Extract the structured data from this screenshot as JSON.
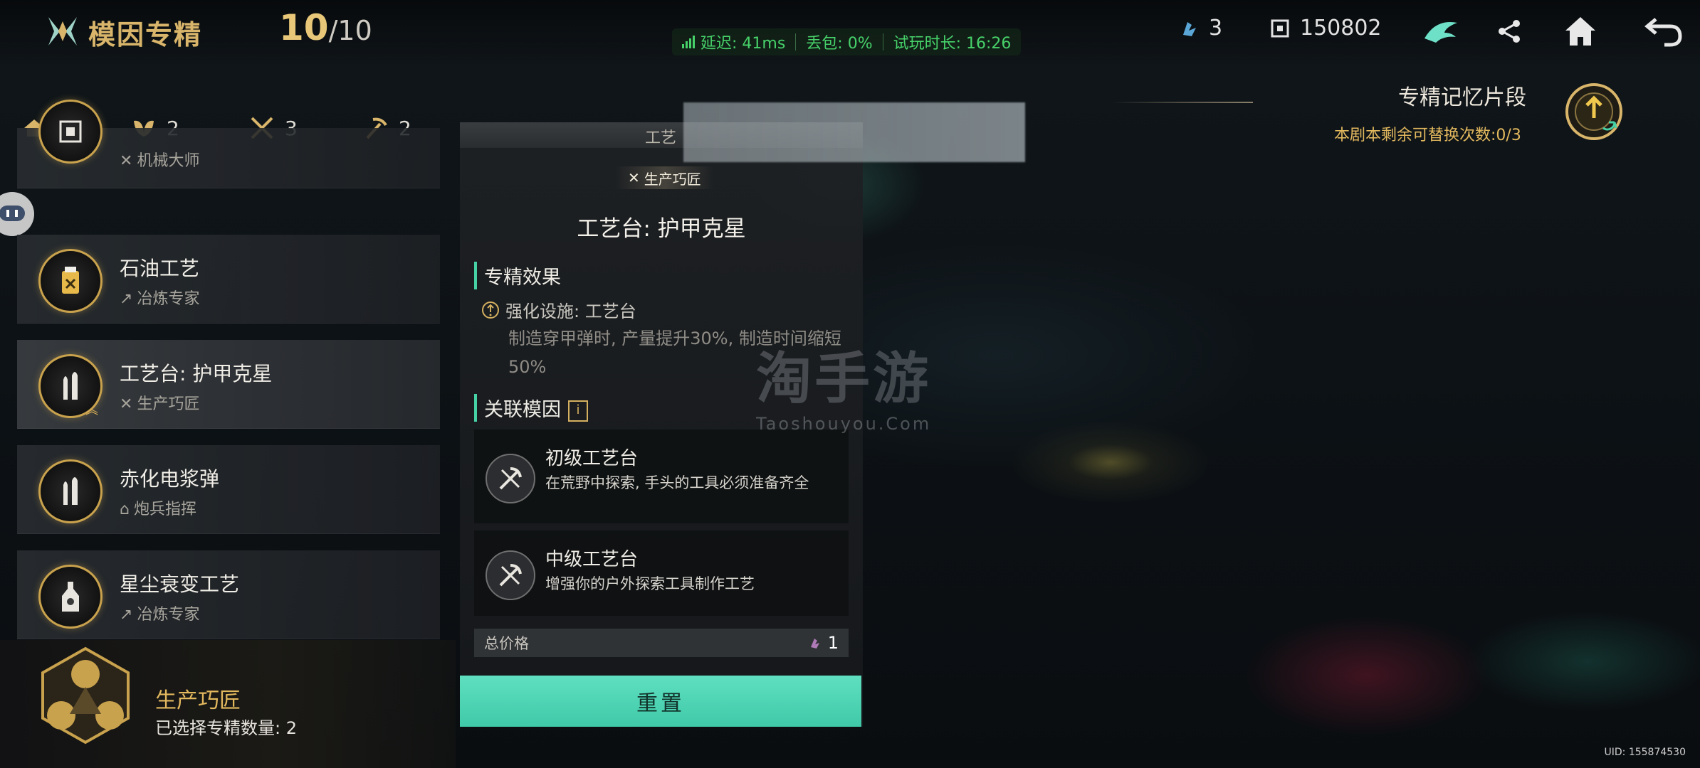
{
  "header": {
    "title": "模因专精",
    "count_current": "10",
    "count_max": "10",
    "count_sep": "/"
  },
  "netstat": {
    "latency": "延迟: 41ms",
    "packet_loss": "丢包: 0%",
    "trial_time": "试玩时长: 16:26"
  },
  "resources": {
    "fragment_count": "3",
    "currency_count": "150802"
  },
  "filters": [
    {
      "icon": "house-icon",
      "count": "3"
    },
    {
      "icon": "leaf-icon",
      "count": "2"
    },
    {
      "icon": "crossed-tools-icon",
      "count": "3"
    },
    {
      "icon": "pickaxe-icon",
      "count": "2"
    }
  ],
  "list": {
    "items": [
      {
        "title": "",
        "sub": "机械大师",
        "sub_icon": "✕"
      },
      {
        "title": "石油工艺",
        "sub": "冶炼专家",
        "sub_icon": "↗"
      },
      {
        "title": "工艺台: 护甲克星",
        "sub": "生产巧匠",
        "sub_icon": "✕"
      },
      {
        "title": "赤化电浆弹",
        "sub": "炮兵指挥",
        "sub_icon": "⌂"
      },
      {
        "title": "星尘衰变工艺",
        "sub": "冶炼专家",
        "sub_icon": "↗"
      }
    ]
  },
  "bottom_card": {
    "title": "生产巧匠",
    "selected": "已选择专精数量: 2"
  },
  "detail": {
    "tab": "工艺",
    "tag": "生产巧匠",
    "title": "工艺台: 护甲克星",
    "effect_header": "专精效果",
    "effect_name": "强化设施: 工艺台",
    "effect_text": "制造穿甲弹时, 产量提升30%, 制造时间缩短50%",
    "related_header": "关联模因",
    "related_info": "i",
    "genes": [
      {
        "name": "初级工艺台",
        "desc": "在荒野中探索, 手头的工具必须准备齐全"
      },
      {
        "name": "中级工艺台",
        "desc": "增强你的户外探索工具制作工艺"
      }
    ],
    "price_label": "总价格",
    "price_value": "1",
    "reset_label": "重置"
  },
  "memory": {
    "title": "专精记忆片段",
    "sub": "本剧本剩余可替换次数:0/3"
  },
  "watermark": {
    "big": "淘手游",
    "small": "Taoshouyou.Com"
  },
  "uid": "UID: 155874530",
  "colors": {
    "accent_gold": "#d8b56a",
    "accent_teal": "#47d2a5",
    "reset_button": "#4fd6b5",
    "net_green": "#47d26a"
  }
}
